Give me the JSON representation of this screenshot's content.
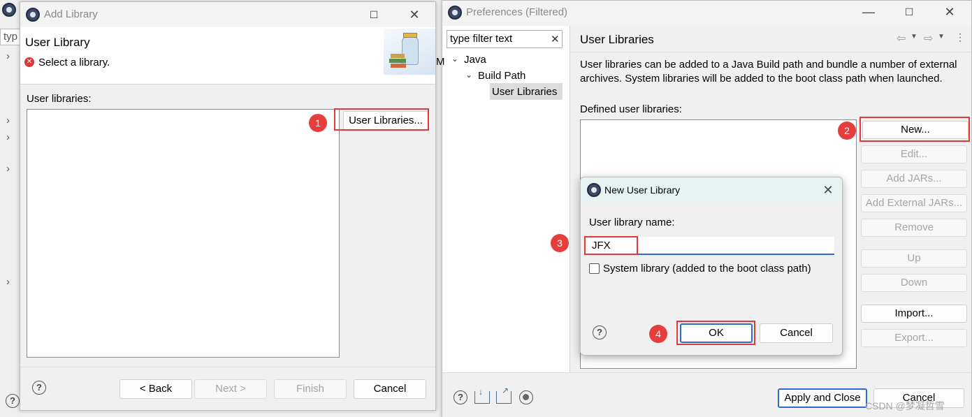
{
  "add_library": {
    "title": "Add Library",
    "heading": "User Library",
    "message": "Select a library.",
    "list_label": "User libraries:",
    "user_libraries_button": "User Libraries...",
    "back_button": "< Back",
    "next_button": "Next >",
    "finish_button": "Finish",
    "cancel_button": "Cancel"
  },
  "background": {
    "search_fragment": "typ",
    "side_letter": "M"
  },
  "preferences": {
    "title": "Preferences (Filtered)",
    "filter_placeholder": "type filter text",
    "tree": {
      "java": "Java",
      "build_path": "Build Path",
      "user_libraries": "User Libraries"
    },
    "page_title": "User Libraries",
    "description": "User libraries can be added to a Java Build path and bundle a number of external archives. System libraries will be added to the boot class path when launched.",
    "defined_label": "Defined user libraries:",
    "buttons": {
      "new": "New...",
      "edit": "Edit...",
      "add_jars": "Add JARs...",
      "add_external_jars": "Add External JARs...",
      "remove": "Remove",
      "up": "Up",
      "down": "Down",
      "import": "Import...",
      "export": "Export..."
    },
    "apply_close_button": "Apply and Close",
    "cancel_button": "Cancel"
  },
  "new_user_library": {
    "title": "New User Library",
    "name_label": "User library name:",
    "name_value": "JFX",
    "system_library_label": "System library (added to the boot class path)",
    "system_library_checked": false,
    "ok_button": "OK",
    "cancel_button": "Cancel"
  },
  "annotations": {
    "step1": "1",
    "step2": "2",
    "step3": "3",
    "step4": "4"
  },
  "watermark": "CSDN @梦凝哲雪",
  "colors": {
    "annotation_red": "#e23a3a",
    "default_button_blue": "#2b6cd4",
    "dialog_title_bg": "#e6f3f3",
    "error_icon": "#d93a3a"
  }
}
